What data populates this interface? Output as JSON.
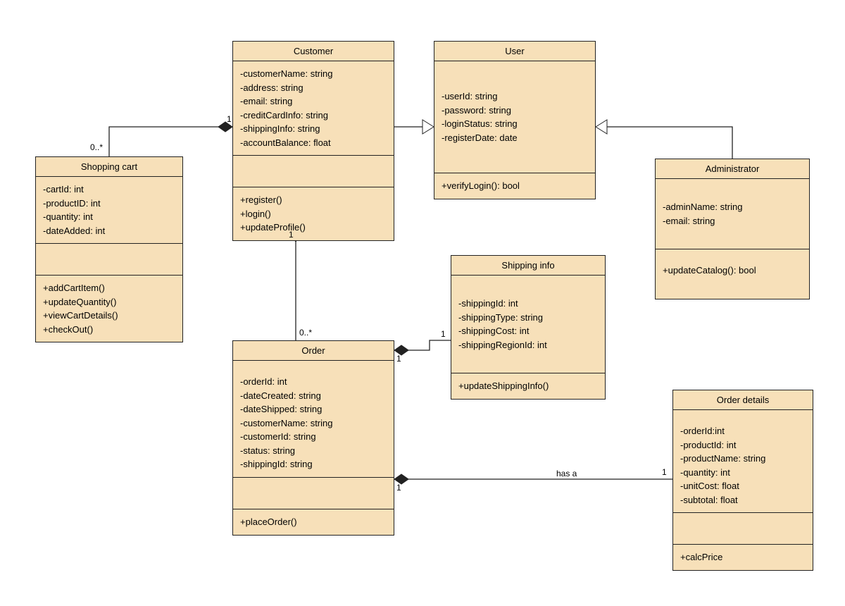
{
  "classes": {
    "shoppingCart": {
      "name": "Shopping cart",
      "attributes": [
        "-cartId: int",
        "-productID: int",
        "-quantity: int",
        "-dateAdded: int"
      ],
      "methods": [
        "+addCartItem()",
        "+updateQuantity()",
        "+viewCartDetails()",
        "+checkOut()"
      ]
    },
    "customer": {
      "name": "Customer",
      "attributes": [
        "-customerName: string",
        "-address: string",
        "-email: string",
        "-creditCardInfo: string",
        "-shippingInfo: string",
        "-accountBalance: float"
      ],
      "methods": [
        "+register()",
        "+login()",
        "+updateProfile()"
      ]
    },
    "user": {
      "name": "User",
      "attributes": [
        "-userId: string",
        "-password: string",
        "-loginStatus: string",
        "-registerDate: date"
      ],
      "methods": [
        "+verifyLogin(): bool"
      ]
    },
    "administrator": {
      "name": "Administrator",
      "attributes": [
        "-adminName: string",
        "-email: string"
      ],
      "methods": [
        "+updateCatalog(): bool"
      ]
    },
    "order": {
      "name": "Order",
      "attributes": [
        "-orderId: int",
        "-dateCreated: string",
        "-dateShipped: string",
        "-customerName: string",
        "-customerId: string",
        "-status: string",
        "-shippingId: string"
      ],
      "methods": [
        "+placeOrder()"
      ]
    },
    "shippingInfo": {
      "name": "Shipping info",
      "attributes": [
        "-shippingId: int",
        "-shippingType: string",
        "-shippingCost: int",
        "-shippingRegionId: int"
      ],
      "methods": [
        "+updateShippingInfo()"
      ]
    },
    "orderDetails": {
      "name": "Order details",
      "attributes": [
        "-orderId:int",
        "-productId: int",
        "-productName: string",
        "-quantity: int",
        "-unitCost: float",
        "-subtotal: float"
      ],
      "methods": [
        "+calcPrice"
      ]
    }
  },
  "multiplicities": {
    "cartCustomer_cart": "0..*",
    "cartCustomer_cust": "1",
    "customerOrder_cust": "1",
    "customerOrder_ord": "0..*",
    "orderShipping_ord": "1",
    "orderShipping_ship": "1",
    "orderDetails_ord": "1",
    "orderDetails_det": "1"
  },
  "relationLabels": {
    "orderDetails": "has a"
  }
}
